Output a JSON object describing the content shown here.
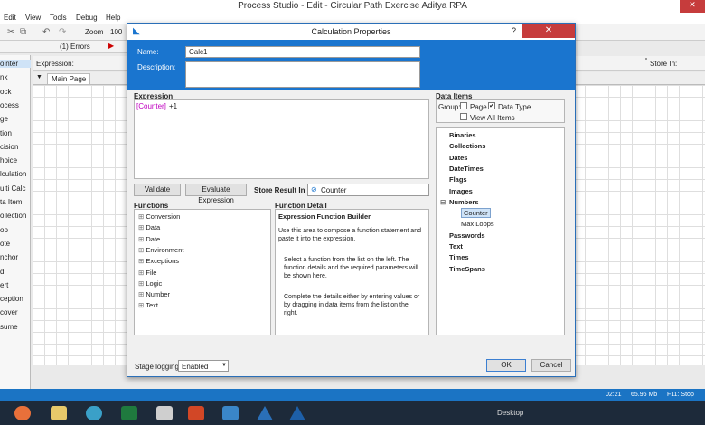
{
  "window": {
    "title": "Process Studio  - Edit - Circular Path Exercise Aditya RPA"
  },
  "menu": [
    "Edit",
    "View",
    "Tools",
    "Debug",
    "Help"
  ],
  "toolbar": {
    "zoom_label": "Zoom",
    "zoom_value": "100",
    "errors_label": "(1) Errors",
    "extra": "6"
  },
  "expression_bar": {
    "label": "Expression:",
    "store_in_label": "Store In:"
  },
  "tabs": {
    "main_page": "Main Page"
  },
  "left_panel": [
    "ointer",
    "nk",
    "ock",
    "ocess",
    "ge",
    "tion",
    "cision",
    "hoice",
    "lculation",
    "ulti Calc",
    "ta Item",
    "ollection",
    "op",
    "ote",
    "nchor",
    "d",
    "ert",
    "ception",
    "cover",
    "sume"
  ],
  "dialog": {
    "title": "Calculation Properties",
    "help": "?",
    "minimize": "—",
    "maximize": "□",
    "close": "✕",
    "name_label": "Name:",
    "name_value": "Calc1",
    "description_label": "Description:",
    "expression_label": "Expression",
    "expression_counter": "[Counter]",
    "expression_rest": "+1",
    "validate": "Validate",
    "evaluate": "Evaluate Expression",
    "store_result_label": "Store Result In",
    "store_result_value": "Counter",
    "data_items_label": "Data Items",
    "group_label": "Group:",
    "group_page": "Page",
    "group_datatype": "Data Type",
    "view_all": "View All Items",
    "data_tree": [
      "Binaries",
      "Collections",
      "Dates",
      "DateTimes",
      "Flags",
      "Images",
      "Numbers",
      "Counter",
      "Max Loops",
      "Passwords",
      "Text",
      "Times",
      "TimeSpans"
    ],
    "functions_label": "Functions",
    "functions": [
      "Conversion",
      "Data",
      "Date",
      "Environment",
      "Exceptions",
      "File",
      "Logic",
      "Number",
      "Text"
    ],
    "function_detail_label": "Function Detail",
    "builder_title": "Expression Function Builder",
    "builder_p1": "Use this area to compose a function statement and paste it into the expression.",
    "builder_p2": "Select a function from the list on the left. The function details and the required parameters will be shown here.",
    "builder_p3": "Complete the details either by entering values or by dragging in data items from the list on the right.",
    "stage_logging_label": "Stage logging:",
    "stage_logging_value": "Enabled",
    "ok": "OK",
    "cancel": "Cancel"
  },
  "status": {
    "time": "02:21",
    "memory": "65.96 Mb",
    "hint": "F11: Stop"
  },
  "taskbar": {
    "desktop": "Desktop"
  }
}
